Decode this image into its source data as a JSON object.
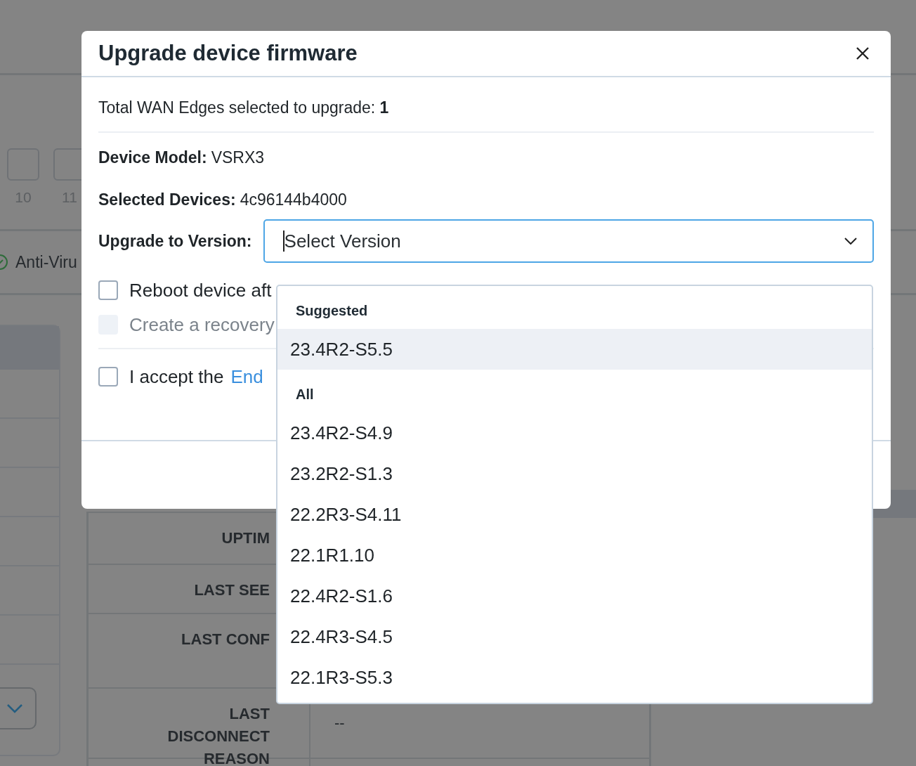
{
  "background": {
    "steps": [
      "10",
      "11"
    ],
    "filter_label": "Anti-Viru",
    "table_rows": [
      {
        "label": "UPTIM"
      },
      {
        "label": "LAST SEE"
      },
      {
        "label": "LAST CONF"
      },
      {
        "label": "LAST DISCONNECT REASON",
        "value": "--"
      }
    ]
  },
  "modal": {
    "title": "Upgrade device firmware",
    "summary": "Total WAN Edges selected to upgrade: **1**",
    "fields": [
      {
        "label": "Device Model:",
        "value": "VSRX3"
      },
      {
        "label": "Selected Devices:",
        "value": "4c96144b4000"
      }
    ],
    "version": {
      "label": "Upgrade to Version:",
      "placeholder": "Select Version"
    },
    "options": [
      {
        "label": "Reboot device aft",
        "checked": false,
        "disabled": false
      },
      {
        "label": "Create a recovery",
        "checked": false,
        "disabled": true
      }
    ],
    "accept": {
      "text": "I accept the",
      "link": "End",
      "checked": false
    }
  },
  "dropdown": {
    "groups": [
      {
        "heading": "Suggested",
        "items": [
          {
            "label": "23.4R2-S5.5",
            "selected": true
          }
        ]
      },
      {
        "heading": "All",
        "items": [
          {
            "label": "23.4R2-S4.9",
            "selected": false
          },
          {
            "label": "23.2R2-S1.3",
            "selected": false
          },
          {
            "label": "22.2R3-S4.11",
            "selected": false
          },
          {
            "label": "22.1R1.10",
            "selected": false
          },
          {
            "label": "22.4R2-S1.6",
            "selected": false
          },
          {
            "label": "22.4R3-S4.5",
            "selected": false
          },
          {
            "label": "22.1R3-S5.3",
            "selected": false
          }
        ]
      }
    ]
  }
}
